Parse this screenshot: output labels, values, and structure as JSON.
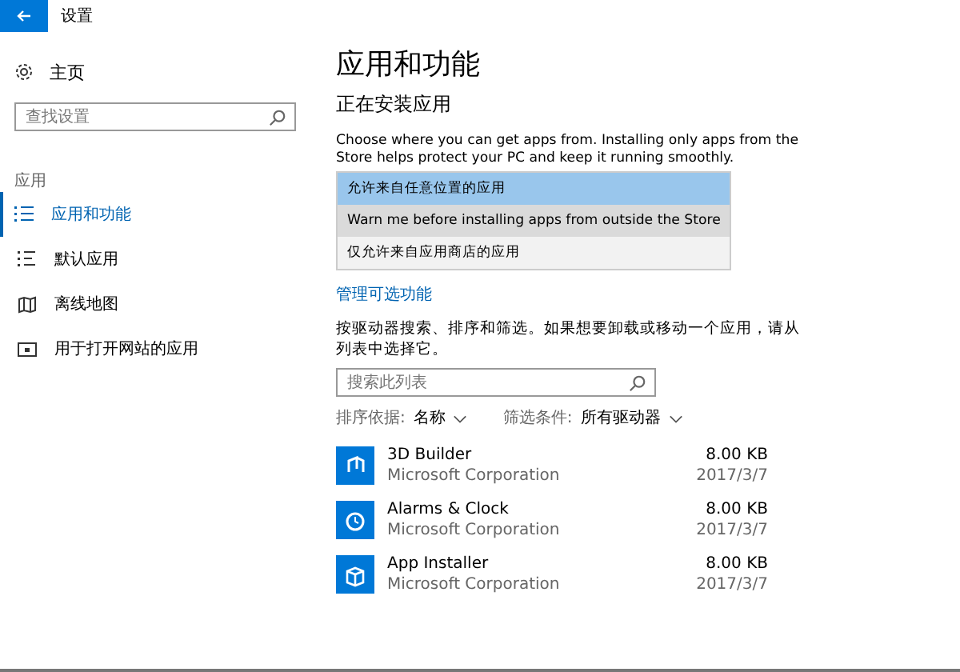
{
  "window": {
    "title": "设置"
  },
  "sidebar": {
    "home": "主页",
    "search": {
      "placeholder": "查找设置"
    },
    "section": "应用",
    "items": [
      {
        "label": "应用和功能",
        "kind": "list",
        "selected": true
      },
      {
        "label": "默认应用",
        "kind": "defaults",
        "selected": false
      },
      {
        "label": "离线地图",
        "kind": "map",
        "selected": false
      },
      {
        "label": "用于打开网站的应用",
        "kind": "web",
        "selected": false
      }
    ]
  },
  "main": {
    "title": "应用和功能",
    "subtitle": "正在安装应用",
    "description": "Choose where you can get apps from. Installing only apps from the Store helps protect your PC and keep it running smoothly.",
    "install_options": [
      {
        "label": "允许来自任意位置的应用",
        "selected": true,
        "highlighted": false
      },
      {
        "label": "Warn me before installing apps from outside the Store",
        "selected": false,
        "highlighted": true
      },
      {
        "label": "仅允许来自应用商店的应用",
        "selected": false,
        "highlighted": false
      }
    ],
    "link": "管理可选功能",
    "list_description": "按驱动器搜索、排序和筛选。如果想要卸载或移动一个应用，请从列表中选择它。",
    "list_search": {
      "placeholder": "搜索此列表"
    },
    "sort": {
      "label": "排序依据:",
      "value": "名称"
    },
    "filter": {
      "label": "筛选条件:",
      "value": "所有驱动器"
    },
    "apps": [
      {
        "name": "3D Builder",
        "publisher": "Microsoft Corporation",
        "size": "8.00 KB",
        "date": "2017/3/7",
        "kind": "builder"
      },
      {
        "name": "Alarms & Clock",
        "publisher": "Microsoft Corporation",
        "size": "8.00 KB",
        "date": "2017/3/7",
        "kind": "clock"
      },
      {
        "name": "App Installer",
        "publisher": "Microsoft Corporation",
        "size": "8.00 KB",
        "date": "2017/3/7",
        "kind": "installer"
      }
    ]
  }
}
